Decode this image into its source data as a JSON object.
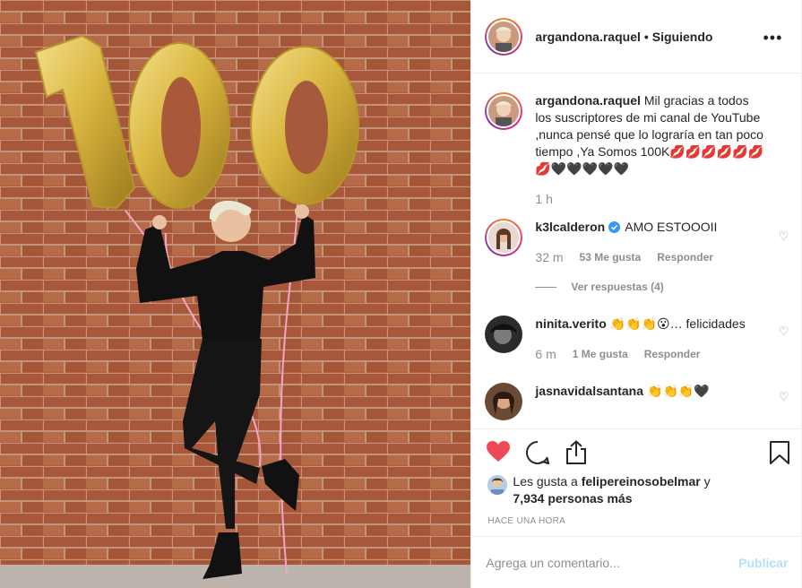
{
  "header": {
    "username": "argandona.raquel",
    "separator": "•",
    "follow_status": "Siguiendo",
    "more_label": "•••"
  },
  "caption": {
    "username": "argandona.raquel",
    "text": "Mil gracias a todos los suscriptores de mi canal de YouTube ,nunca pensé que lo lograría en tan poco tiempo ,Ya Somos 100K💋💋💋💋💋💋💋🖤🖤🖤🖤🖤",
    "time": "1 h"
  },
  "comments": [
    {
      "username": "k3lcalderon",
      "verified": true,
      "text": "AMO ESTOOOII",
      "time": "32 m",
      "likes": "53 Me gusta",
      "reply": "Responder",
      "view_replies": "Ver respuestas (4)"
    },
    {
      "username": "ninita.verito",
      "text": "👏👏👏😮… felicidades",
      "time": "6 m",
      "likes": "1 Me gusta",
      "reply": "Responder"
    },
    {
      "username": "jasnavidalsantana",
      "text": "👏👏👏🖤"
    }
  ],
  "likes_summary": {
    "prefix": "Les gusta a",
    "user": "felipereinosobelmar",
    "connector": "y",
    "others": "7,934 personas más"
  },
  "timestamp": "HACE UNA HORA",
  "comment_box": {
    "placeholder": "Agrega un comentario...",
    "post_label": "Publicar"
  },
  "photo": {
    "balloon_text": "100"
  },
  "colors": {
    "like_red": "#ed4956",
    "verified_blue": "#3897f0",
    "muted": "#8e8e8e",
    "brick": "#a55a3c",
    "balloon_gold": "#d9b640"
  },
  "icons": [
    "heart-filled-icon",
    "comment-icon",
    "share-icon",
    "bookmark-icon",
    "more-icon",
    "verified-icon",
    "heart-outline-icon"
  ]
}
